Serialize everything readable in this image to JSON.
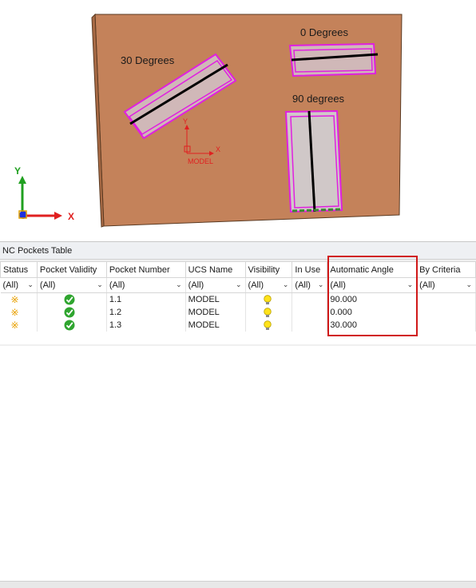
{
  "viewport": {
    "label_30": "30 Degrees",
    "label_0": "0 Degrees",
    "label_90": "90 degrees",
    "ucs_x": "X",
    "ucs_y": "Y",
    "ucs_name": "MODEL",
    "triad_x": "X",
    "triad_y": "Y",
    "colors": {
      "block": "#c4825a",
      "pocket_outline": "#e020e0",
      "triad_x": "#e02020",
      "triad_y": "#20a020",
      "triad_z": "#2030e0"
    }
  },
  "panel": {
    "title": "NC Pockets Table",
    "columns": [
      "Status",
      "Pocket Validity",
      "Pocket Number",
      "UCS Name",
      "Visibility",
      "In Use",
      "Automatic Angle",
      "By Criteria"
    ],
    "filters": [
      "(All)",
      "(All)",
      "(All)",
      "(All)",
      "(All)",
      "(All)",
      "(All)",
      "(All)"
    ],
    "rows": [
      {
        "status_icon": "status-star-icon",
        "validity_icon": "check-icon",
        "pocket_number": "1.1",
        "ucs_name": "MODEL",
        "visibility_icon": "bulb-icon",
        "in_use": "",
        "automatic_angle": "90.000",
        "by_criteria": ""
      },
      {
        "status_icon": "status-star-icon",
        "validity_icon": "check-icon",
        "pocket_number": "1.2",
        "ucs_name": "MODEL",
        "visibility_icon": "bulb-icon",
        "in_use": "",
        "automatic_angle": "0.000",
        "by_criteria": ""
      },
      {
        "status_icon": "status-star-icon",
        "validity_icon": "check-icon",
        "pocket_number": "1.3",
        "ucs_name": "MODEL",
        "visibility_icon": "bulb-icon",
        "in_use": "",
        "automatic_angle": "30.000",
        "by_criteria": ""
      }
    ],
    "highlight_color": "#d01818"
  }
}
